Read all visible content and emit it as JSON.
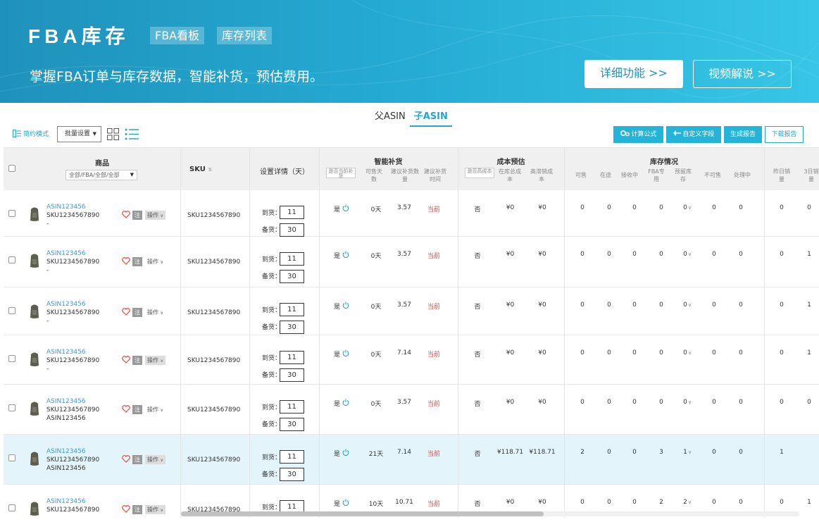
{
  "banner": {
    "title": "FBA库存",
    "tag_board": "FBA看板",
    "tag_list": "库存列表",
    "subtitle": "掌握FBA订单与库存数据，智能补货，预估费用。",
    "btn_detail": "详细功能 >>",
    "btn_video": "视频解说 >>"
  },
  "asin_tabs": {
    "parent": "父ASIN",
    "child": "子ASIN"
  },
  "toolbar": {
    "simple_mode": "简约模式",
    "batch_settings": "批量设置",
    "calc_formula": "计算公式",
    "custom_fields": "自定义字段",
    "generate_report": "生成报告",
    "download_report": "下载报告"
  },
  "columns": {
    "product": "商品",
    "product_filter": "全部/FBA/全部/全部",
    "sku": "SKU",
    "settings": "设置详情（天）",
    "smart_replenish": "智能补货",
    "sr_is_current": "是否当前补货",
    "sr_days": "可售天数",
    "sr_qty": "建议补货数量",
    "sr_time": "建议补货时间",
    "cost_estimate": "成本预估",
    "ce_high": "是否高成本",
    "ce_total": "在库总成本",
    "ce_stale": "高滞销成本",
    "inventory": "库存情况",
    "inv_sellable": "可售",
    "inv_transit": "在途",
    "inv_receiving": "接收中",
    "inv_fba": "FBA专用",
    "inv_reserved": "预留库存",
    "inv_unsellable": "不可售",
    "inv_processing": "处理中",
    "sales_yesterday": "昨日销量",
    "sales_3d": "3日销量"
  },
  "row_labels": {
    "arrival": "到货：",
    "stock": "备货：",
    "op": "操作"
  },
  "rows": [
    {
      "asin": "ASIN123456",
      "sku": "SKU1234567890",
      "extra": "-",
      "arrival": "11",
      "stock": "30",
      "is_current": "是",
      "days": "0天",
      "qty": "3.57",
      "time": "当前",
      "high_cost": "否",
      "total_cost": "¥0",
      "stale_cost": "¥0",
      "sellable": "0",
      "transit": "0",
      "receiving": "0",
      "fba": "0",
      "reserved": "0",
      "unsellable": "0",
      "processing": "0",
      "yesterday": "0",
      "d3": "0",
      "op_boxed": true
    },
    {
      "asin": "ASIN123456",
      "sku": "SKU1234567890",
      "extra": "-",
      "arrival": "11",
      "stock": "30",
      "is_current": "是",
      "days": "0天",
      "qty": "3.57",
      "time": "当前",
      "high_cost": "否",
      "total_cost": "¥0",
      "stale_cost": "¥0",
      "sellable": "0",
      "transit": "0",
      "receiving": "0",
      "fba": "0",
      "reserved": "0",
      "unsellable": "0",
      "processing": "0",
      "yesterday": "0",
      "d3": "1",
      "op_boxed": false
    },
    {
      "asin": "ASIN123456",
      "sku": "SKU1234567890",
      "extra": "-",
      "arrival": "11",
      "stock": "30",
      "is_current": "是",
      "days": "0天",
      "qty": "3.57",
      "time": "当前",
      "high_cost": "否",
      "total_cost": "¥0",
      "stale_cost": "¥0",
      "sellable": "0",
      "transit": "0",
      "receiving": "0",
      "fba": "0",
      "reserved": "0",
      "unsellable": "0",
      "processing": "0",
      "yesterday": "0",
      "d3": "1",
      "op_boxed": false
    },
    {
      "asin": "ASIN123456",
      "sku": "SKU1234567890",
      "extra": "-",
      "arrival": "11",
      "stock": "30",
      "is_current": "是",
      "days": "0天",
      "qty": "7.14",
      "time": "当前",
      "high_cost": "否",
      "total_cost": "¥0",
      "stale_cost": "¥0",
      "sellable": "0",
      "transit": "0",
      "receiving": "0",
      "fba": "0",
      "reserved": "0",
      "unsellable": "0",
      "processing": "0",
      "yesterday": "0",
      "d3": "1",
      "op_boxed": true
    },
    {
      "asin": "ASIN123456",
      "sku": "SKU1234567890",
      "extra": "ASIN123456",
      "arrival": "11",
      "stock": "30",
      "is_current": "是",
      "days": "0天",
      "qty": "3.57",
      "time": "当前",
      "high_cost": "否",
      "total_cost": "¥0",
      "stale_cost": "¥0",
      "sellable": "0",
      "transit": "0",
      "receiving": "0",
      "fba": "0",
      "reserved": "0",
      "unsellable": "0",
      "processing": "0",
      "yesterday": "0",
      "d3": "0",
      "op_boxed": false
    },
    {
      "asin": "ASIN123456",
      "sku": "SKU1234567890",
      "extra": "ASIN123456",
      "arrival": "11",
      "stock": "30",
      "is_current": "是",
      "days": "21天",
      "qty": "7.14",
      "time": "当前",
      "high_cost": "否",
      "total_cost": "¥118.71",
      "stale_cost": "¥118.71",
      "sellable": "2",
      "transit": "0",
      "receiving": "0",
      "fba": "3",
      "reserved": "1",
      "unsellable": "0",
      "processing": "0",
      "yesterday": "1",
      "d3": "",
      "op_boxed": true
    },
    {
      "asin": "ASIN123456",
      "sku": "SKU1234567890",
      "extra": "",
      "arrival": "11",
      "stock": "",
      "is_current": "是",
      "days": "10天",
      "qty": "10.71",
      "time": "当前",
      "high_cost": "否",
      "total_cost": "¥0",
      "stale_cost": "¥0",
      "sellable": "0",
      "transit": "0",
      "receiving": "0",
      "fba": "2",
      "reserved": "2",
      "unsellable": "0",
      "processing": "0",
      "yesterday": "0",
      "d3": "1",
      "op_boxed": true
    }
  ],
  "highlight_row": 5,
  "colors": {
    "accent": "#25a6cf",
    "red": "#e54d42",
    "highlight": "#e3f5fa"
  }
}
